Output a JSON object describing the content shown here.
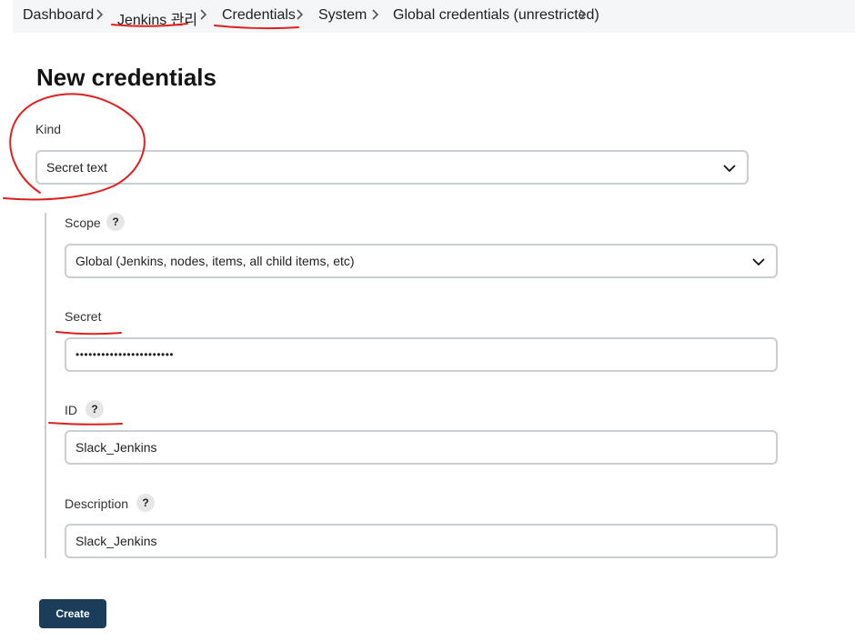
{
  "breadcrumb": [
    {
      "label": "Dashboard"
    },
    {
      "label": "Jenkins 관리"
    },
    {
      "label": "Credentials"
    },
    {
      "label": "System"
    },
    {
      "label": "Global credentials (unrestricted)"
    }
  ],
  "page_title": "New credentials",
  "form": {
    "kind": {
      "label": "Kind",
      "value": "Secret text"
    },
    "scope": {
      "label": "Scope",
      "help": "?",
      "value": "Global (Jenkins, nodes, items, all child items, etc)"
    },
    "secret": {
      "label": "Secret",
      "value": "•••••••••••••••••••••••"
    },
    "id": {
      "label": "ID",
      "help": "?",
      "value": "Slack_Jenkins"
    },
    "description": {
      "label": "Description",
      "help": "?",
      "value": "Slack_Jenkins"
    }
  },
  "create_button": "Create",
  "colors": {
    "annotation": "#e02020",
    "button_bg": "#1c3d5a",
    "breadcrumb_bg": "#f5f6f7",
    "input_border": "#c9ced3"
  }
}
